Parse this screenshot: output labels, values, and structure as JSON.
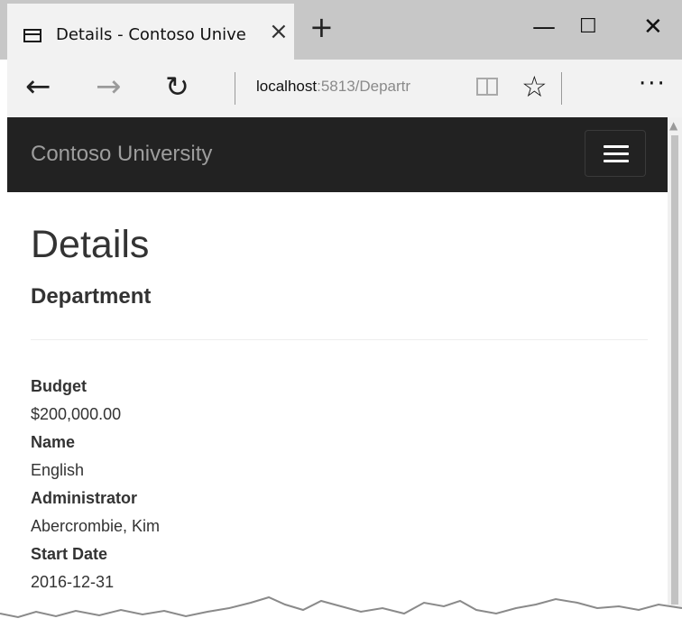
{
  "browser": {
    "tab_title": "Details - Contoso Unive",
    "tab_close": "×",
    "new_tab": "+",
    "minimize": "—",
    "maximize": "☐",
    "close": "✕",
    "back": "←",
    "forward": "→",
    "refresh": "↻",
    "address_host": "localhost",
    "address_path": ":5813/Departr",
    "favorite": "☆",
    "more": "···"
  },
  "site": {
    "brand": "Contoso University"
  },
  "page": {
    "title": "Details",
    "subtitle": "Department",
    "fields": [
      {
        "label": "Budget",
        "value": "$200,000.00"
      },
      {
        "label": "Name",
        "value": "English"
      },
      {
        "label": "Administrator",
        "value": "Abercrombie, Kim"
      },
      {
        "label": "Start Date",
        "value": "2016-12-31"
      }
    ]
  },
  "colors": {
    "navbar_bg": "#222222",
    "brand_text": "#9d9d9d",
    "tabbar_bg": "#c7c7c7",
    "text": "#333333"
  }
}
